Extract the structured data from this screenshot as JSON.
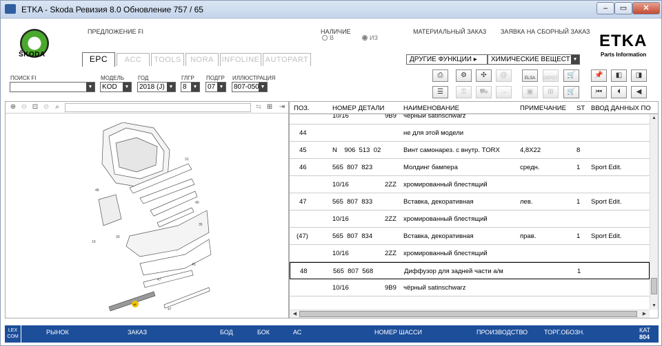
{
  "window": {
    "title": "ETKA - Skoda Ревизия 8.0 Обновление 757 / 65",
    "min": "–",
    "max": "▭",
    "close": "✕"
  },
  "header": {
    "logo_text": "ŠKODA",
    "proposal": "ПРЕДЛОЖЕНИЕ FI",
    "availability": {
      "label": "НАЛИЧИЕ",
      "opt1": "В",
      "opt2": "ИЗ"
    },
    "material_order": "МАТЕРИАЛЬНЫЙ ЗАКАЗ",
    "assembly_order": "ЗАЯВКА НА СБОРНЫЙ ЗАКАЗ",
    "brand": "ETKA",
    "brand_sub": "Parts Information",
    "other_functions": "ДРУГИЕ ФУНКЦИИ ▸",
    "chemicals": "ХИМИЧЕСКИЕ ВЕЩЕСТ"
  },
  "tabs": [
    {
      "label": "EPC",
      "active": true
    },
    {
      "label": "ACC"
    },
    {
      "label": "TOOLS"
    },
    {
      "label": "NORA"
    },
    {
      "label": "INFOLINE"
    },
    {
      "label": "AUTOPART"
    }
  ],
  "filters": {
    "search_label": "ПОИСК FI",
    "search_value": "",
    "model_label": "МОДЕЛЬ",
    "model_value": "KOD",
    "year_label": "ГОД",
    "year_value": "2018 (J)",
    "mgroup_label": "ГЛГР",
    "mgroup_value": "8",
    "sgroup_label": "ПОДГР",
    "sgroup_value": "07",
    "illus_label": "ИЛЛЮСТРАЦИЯ",
    "illus_value": "807-050"
  },
  "toolbar": {
    "elsa": "ELSA",
    "depot": "DEPOT"
  },
  "table": {
    "headers": {
      "pos": "ПОЗ.",
      "part": "НОМЕР ДЕТАЛИ",
      "name": "НАИМЕНОВАНИЕ",
      "note": "ПРИМЕЧАНИЕ",
      "st": "ST",
      "input": "ВВОД ДАННЫХ ПО"
    },
    "rows": [
      {
        "pos": "",
        "part": "10/16",
        "part2": "9B9",
        "name": "чёрный satinschwarz",
        "note": "",
        "st": "",
        "input": ""
      },
      {
        "pos": "44",
        "part": "",
        "part2": "",
        "name": "не для этой модели",
        "note": "",
        "st": "",
        "input": ""
      },
      {
        "pos": "45",
        "part": "N    906  513  02",
        "part2": "",
        "name": "Винт самонарез. с внутр. TORX",
        "note": "4,8X22",
        "st": "8",
        "input": ""
      },
      {
        "pos": "46",
        "part": "565  807  823",
        "part2": "",
        "name": "Молдинг бампера",
        "note": "средн.",
        "st": "1",
        "input": "Sport Edit."
      },
      {
        "pos": "",
        "part": "10/16",
        "part2": "2ZZ",
        "name": "хромированный блестящий",
        "note": "",
        "st": "",
        "input": ""
      },
      {
        "pos": "47",
        "part": "565  807  833",
        "part2": "",
        "name": "Вставка, декоративная",
        "note": "лев.",
        "st": "1",
        "input": "Sport Edit."
      },
      {
        "pos": "",
        "part": "10/16",
        "part2": "2ZZ",
        "name": "хромированный блестящий",
        "note": "",
        "st": "",
        "input": ""
      },
      {
        "pos": "(47)",
        "part": "565  807  834",
        "part2": "",
        "name": "Вставка, декоративная",
        "note": "прав.",
        "st": "1",
        "input": "Sport Edit."
      },
      {
        "pos": "",
        "part": "10/16",
        "part2": "2ZZ",
        "name": "хромированный блестящий",
        "note": "",
        "st": "",
        "input": ""
      },
      {
        "pos": "48",
        "part": "565  807  568",
        "part2": "",
        "name": "Диффузор для задней части а/м",
        "note": "",
        "st": "1",
        "input": ""
      },
      {
        "pos": "",
        "part": "10/16",
        "part2": "9B9",
        "name": "чёрный satinschwarz",
        "note": "",
        "st": "",
        "input": ""
      }
    ]
  },
  "status": {
    "lexcom": "LEX COM",
    "market": "РЫНОК",
    "order": "ЗАКАЗ",
    "bod": "БОД",
    "bok": "БОК",
    "ac": "АС",
    "chassis": "НОМЕР ШАССИ",
    "production": "ПРОИЗВОДСТВО",
    "trade": "ТОРГ.ОБОЗН.",
    "kat_label": "КАТ",
    "kat_value": "804"
  },
  "colors": {
    "statusbar": "#1c4e9a",
    "brand_green": "#4ba82e",
    "callout": "#f2c200"
  }
}
